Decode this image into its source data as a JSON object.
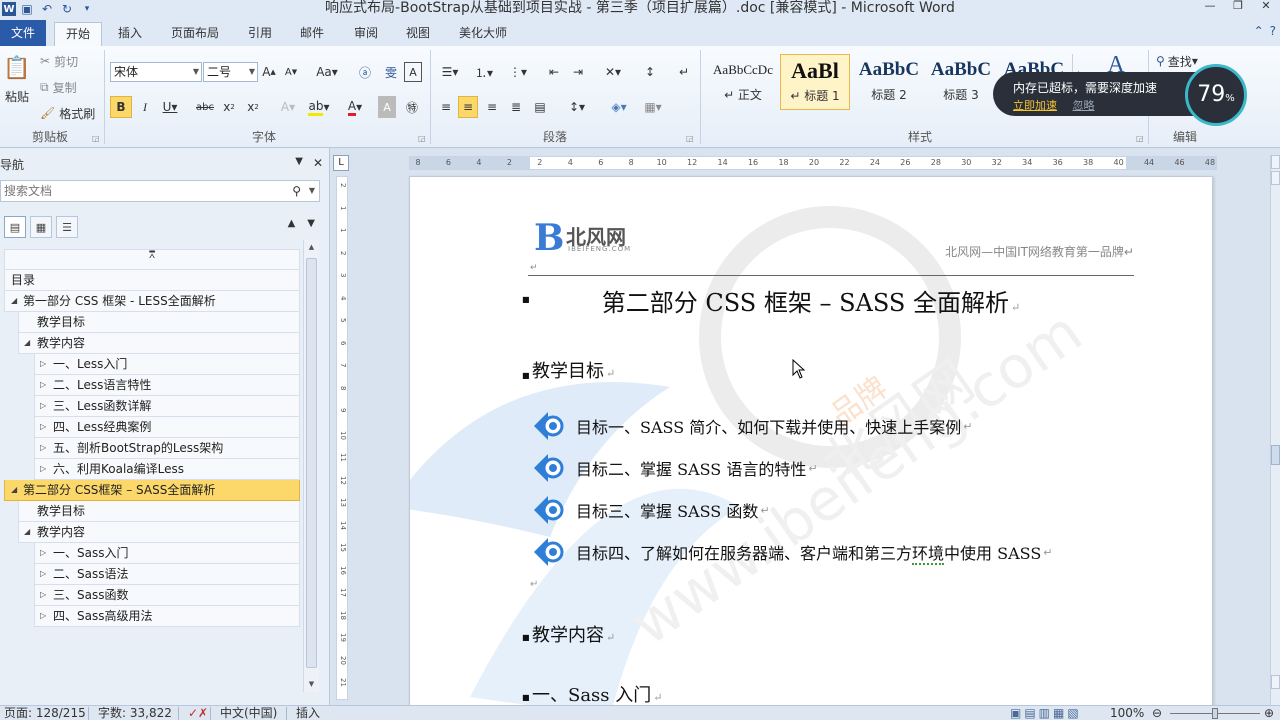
{
  "window": {
    "title": "响应式布局-BootStrap从基础到项目实战 - 第三季（项目扩展篇）.doc [兼容模式] - Microsoft Word",
    "controls": [
      "minimize",
      "restore",
      "close"
    ]
  },
  "ribbon_tabs": [
    "文件",
    "开始",
    "插入",
    "页面布局",
    "引用",
    "邮件",
    "审阅",
    "视图",
    "美化大师"
  ],
  "ribbon": {
    "clipboard": {
      "paste": "粘贴",
      "cut": "剪切",
      "copy": "复制",
      "format_painter": "格式刷",
      "label": "剪贴板"
    },
    "font": {
      "font_name": "宋体",
      "font_size": "二号",
      "label": "字体"
    },
    "paragraph": {
      "label": "段落"
    },
    "styles": {
      "label": "样式",
      "items": [
        {
          "sample": "AaBbCcDc",
          "name": "↵ 正文"
        },
        {
          "sample": "AaBl",
          "name": "↵ 标题 1"
        },
        {
          "sample": "AaBbC",
          "name": "标题 2"
        },
        {
          "sample": "AaBbC",
          "name": "标题 3"
        },
        {
          "sample": "AaBbC",
          "name": ""
        }
      ]
    },
    "editing": {
      "find": "查找",
      "label": "编辑"
    }
  },
  "notification": {
    "message": "内存已超标，需要深度加速",
    "accelerate": "立即加速",
    "ignore": "忽略",
    "percent": "79",
    "unit": "%"
  },
  "nav": {
    "title": "导航",
    "search_placeholder": "搜索文档",
    "items": [
      {
        "label": "目录",
        "level": 0,
        "arrow": ""
      },
      {
        "label": "第一部分  CSS 框架 - LESS全面解析",
        "level": 0,
        "arrow": "◢"
      },
      {
        "label": "教学目标",
        "level": 1,
        "arrow": ""
      },
      {
        "label": "教学内容",
        "level": 1,
        "arrow": "◢"
      },
      {
        "label": "一、Less入门",
        "level": 2,
        "arrow": "▷"
      },
      {
        "label": "二、Less语言特性",
        "level": 2,
        "arrow": "▷"
      },
      {
        "label": "三、Less函数详解",
        "level": 2,
        "arrow": "▷"
      },
      {
        "label": "四、Less经典案例",
        "level": 2,
        "arrow": "▷"
      },
      {
        "label": "五、剖析BootStrap的Less架构",
        "level": 2,
        "arrow": "▷"
      },
      {
        "label": "六、利用Koala编译Less",
        "level": 2,
        "arrow": "▷"
      },
      {
        "label": "第二部分  CSS框架 – SASS全面解析",
        "level": 0,
        "arrow": "◢",
        "selected": true
      },
      {
        "label": "教学目标",
        "level": 1,
        "arrow": ""
      },
      {
        "label": "教学内容",
        "level": 1,
        "arrow": "◢"
      },
      {
        "label": "一、Sass入门",
        "level": 2,
        "arrow": "▷"
      },
      {
        "label": "二、Sass语法",
        "level": 2,
        "arrow": "▷"
      },
      {
        "label": "三、Sass函数",
        "level": 2,
        "arrow": "▷"
      },
      {
        "label": "四、Sass高级用法",
        "level": 2,
        "arrow": "▷"
      }
    ]
  },
  "ruler": {
    "ticks": [
      "8",
      "6",
      "4",
      "2",
      "2",
      "4",
      "6",
      "8",
      "10",
      "12",
      "14",
      "16",
      "18",
      "20",
      "22",
      "24",
      "26",
      "28",
      "30",
      "32",
      "34",
      "36",
      "38",
      "40",
      "44",
      "46",
      "48"
    ],
    "vticks": [
      "2",
      "1",
      "1",
      "2",
      "3",
      "4",
      "5",
      "6",
      "7",
      "8",
      "9",
      "10",
      "11",
      "12",
      "13",
      "14",
      "15",
      "16",
      "17",
      "18",
      "19",
      "20",
      "21"
    ]
  },
  "document": {
    "logo_cn": "北风网",
    "logo_en": "IBEIFENG.COM",
    "header_text": "北风网—中国IT网络教育第一品牌↵",
    "title": "第二部分  CSS 框架  – SASS 全面解析",
    "section1": "教学目标",
    "goals": [
      "目标一、SASS 简介、如何下载并使用、快速上手案例",
      "目标二、掌握 SASS 语言的特性",
      "目标三、掌握 SASS 函数",
      "目标四、了解如何在服务器端、客户端和第三方环境中使用 SASS"
    ],
    "goal4_prefix": "目标四、了解如何在服务器端、客户端和第三方",
    "goal4_squiggle": "环境",
    "goal4_suffix": "中使用 SASS",
    "section2": "教学内容",
    "section3": "一、Sass 入门",
    "para_mark": "↵",
    "watermark_text": "北风网",
    "watermark_brand": "品牌",
    "watermark_url": "www.ibeifeng.com"
  },
  "statusbar": {
    "page": "页面: 128/215",
    "words": "字数: 33,822",
    "language": "中文(中国)",
    "mode": "插入",
    "zoom": "100%"
  },
  "colors": {
    "accent": "#2a5ba8",
    "selected_nav": "#fcd86a",
    "goal_icon": "#2f7fd8",
    "notification_bg": "#2a2f3a",
    "notification_accent": "#f4c430",
    "gauge_ring": "#3bb8c9"
  }
}
